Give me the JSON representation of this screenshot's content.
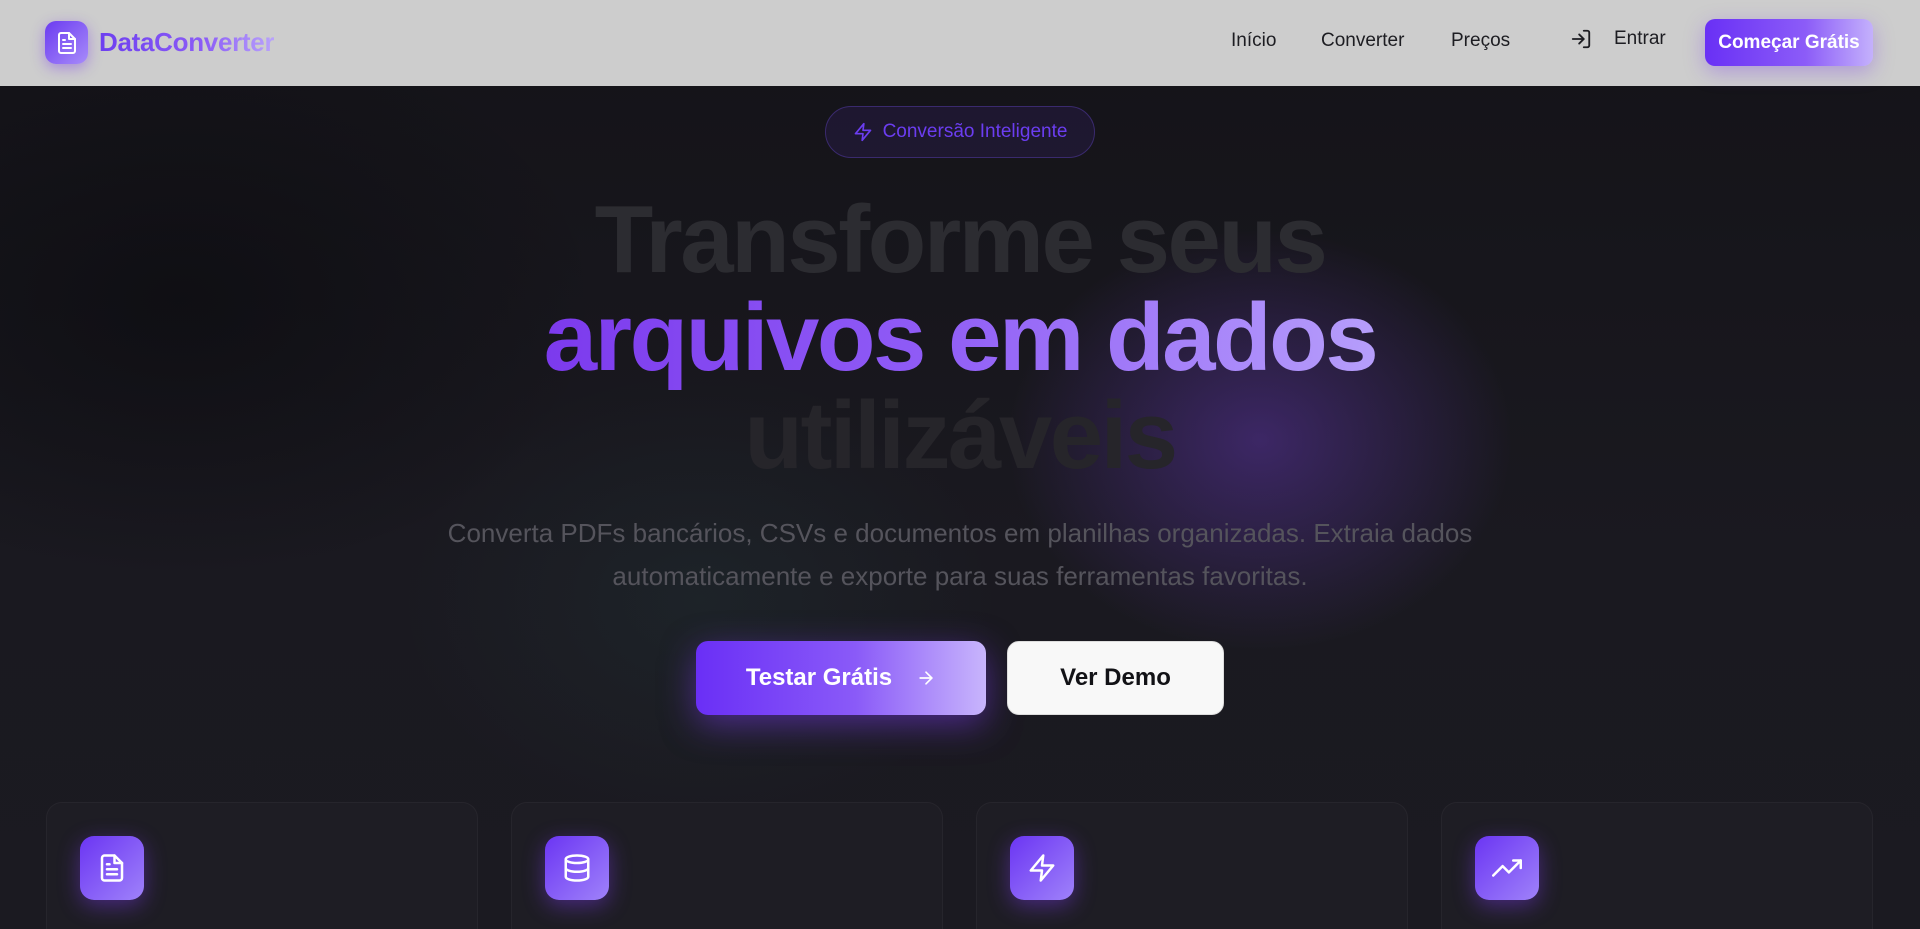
{
  "colors": {
    "accent": "#7c3aed",
    "accent_light": "#a78bfa",
    "navbar_bg": "#cdcdcd",
    "page_bg": "#17161d"
  },
  "brand": {
    "name": "DataConverter",
    "logo_icon": "file-text-icon"
  },
  "nav": {
    "links": [
      {
        "label": "Início"
      },
      {
        "label": "Converter"
      },
      {
        "label": "Preços"
      }
    ],
    "login_icon": "log-in-icon",
    "login_label": "Entrar",
    "cta_label": "Começar Grátis"
  },
  "hero": {
    "badge_icon": "zap-icon",
    "badge_label": "Conversão Inteligente",
    "headline_line1": "Transforme seus",
    "headline_line2": "arquivos em dados",
    "headline_line3": "utilizáveis",
    "subtitle_line1": "Converta PDFs bancários, CSVs e documentos em planilhas organizadas. Extraia dados",
    "subtitle_line2": "automaticamente e exporte para suas ferramentas favoritas.",
    "primary_button": "Testar Grátis",
    "primary_button_icon": "arrow-right-icon",
    "secondary_button": "Ver Demo"
  },
  "features": [
    {
      "icon": "file-text-icon"
    },
    {
      "icon": "database-icon"
    },
    {
      "icon": "zap-icon"
    },
    {
      "icon": "trending-up-icon"
    }
  ]
}
